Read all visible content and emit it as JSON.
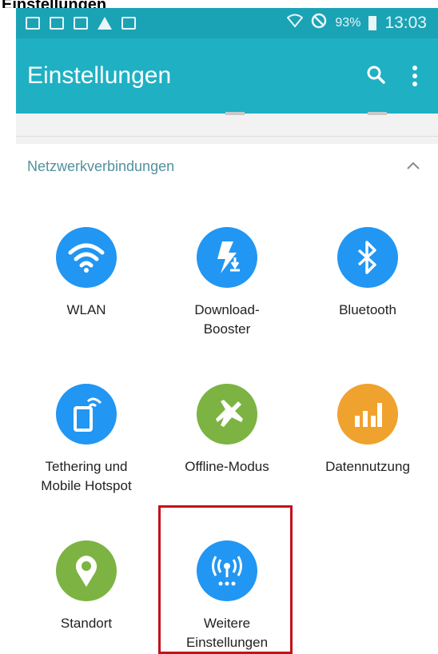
{
  "page_caption": "Einstellungen",
  "status_bar": {
    "battery": "93%",
    "time": "13:03"
  },
  "toolbar": {
    "title": "Einstellungen"
  },
  "section": {
    "title": "Netzwerkverbindungen"
  },
  "tiles": [
    {
      "label": "WLAN",
      "icon": "wifi-icon",
      "color": "#2196f3"
    },
    {
      "label": "Download-\nBooster",
      "icon": "download-booster-icon",
      "color": "#2196f3"
    },
    {
      "label": "Bluetooth",
      "icon": "bluetooth-icon",
      "color": "#2196f3"
    },
    {
      "label": "Tethering und\nMobile Hotspot",
      "icon": "tethering-icon",
      "color": "#2196f3"
    },
    {
      "label": "Offline-Modus",
      "icon": "airplane-icon",
      "color": "#7cb342"
    },
    {
      "label": "Datennutzung",
      "icon": "data-usage-icon",
      "color": "#f0a22e"
    },
    {
      "label": "Standort",
      "icon": "location-icon",
      "color": "#7cb342"
    },
    {
      "label": "Weitere\nEinstellungen",
      "icon": "more-networks-icon",
      "color": "#2196f3"
    }
  ],
  "colors": {
    "status_bar": "#1aa3b5",
    "toolbar": "#1fb0c3",
    "highlight": "#c3121a"
  }
}
